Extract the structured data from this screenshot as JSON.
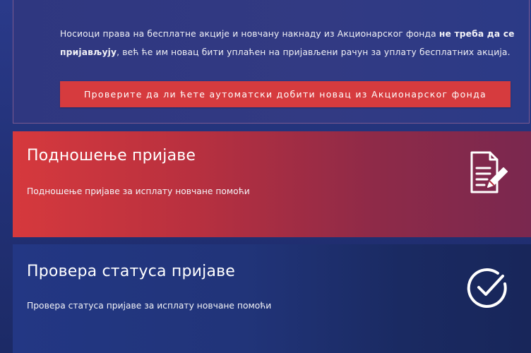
{
  "info": {
    "text_before": "Носиоци права на бесплатне акције и новчану накнаду из Акционарског фонда ",
    "text_bold": "не треба да се пријављују",
    "text_after": ", већ ће им новац бити уплаћен на пријављени рачун за уплату бесплатних акција.",
    "button_label": "Проверите да ли ћете аутоматски добити новац из Акционарског фонда"
  },
  "cards": {
    "submit": {
      "title": "Подношење пријаве",
      "description": "Подношење пријаве за исплату новчане помоћи",
      "icon": "document-pen-icon"
    },
    "status": {
      "title": "Провера статуса пријаве",
      "description": "Провера статуса пријаве за исплату новчане помоћи",
      "icon": "check-circle-icon"
    }
  },
  "colors": {
    "accent_red": "#d63b3e",
    "navy": "#233279"
  }
}
